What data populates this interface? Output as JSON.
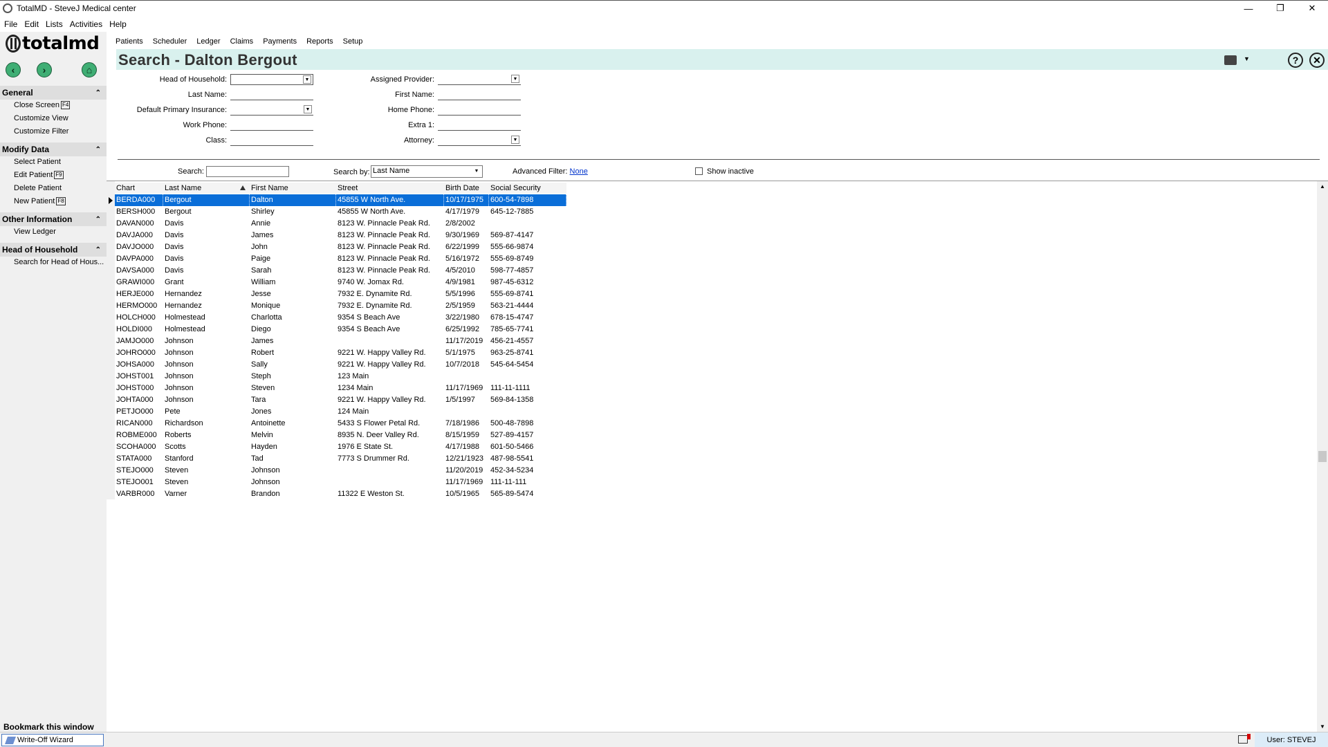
{
  "window": {
    "title": "TotalMD - SteveJ Medical center",
    "minimize_glyph": "—",
    "restore_glyph": "❐",
    "close_glyph": "✕"
  },
  "menubar": [
    "File",
    "Edit",
    "Lists",
    "Activities",
    "Help"
  ],
  "logo": {
    "text": "totalmd"
  },
  "toolbar": {
    "items": [
      "Patients",
      "Scheduler",
      "Ledger",
      "Claims",
      "Payments",
      "Reports",
      "Setup"
    ]
  },
  "nav": {
    "back_glyph": "‹",
    "forward_glyph": "›",
    "home_glyph": "⌂"
  },
  "sidebar": {
    "sections": [
      {
        "title": "General",
        "items": [
          {
            "label": "Close Screen",
            "key": "F4"
          },
          {
            "label": "Customize View",
            "key": ""
          },
          {
            "label": "Customize Filter",
            "key": ""
          }
        ]
      },
      {
        "title": "Modify Data",
        "items": [
          {
            "label": "Select Patient",
            "key": ""
          },
          {
            "label": "Edit Patient",
            "key": "F9"
          },
          {
            "label": "Delete Patient",
            "key": ""
          },
          {
            "label": "New Patient",
            "key": "F8"
          }
        ]
      },
      {
        "title": "Other Information",
        "items": [
          {
            "label": "View Ledger",
            "key": ""
          }
        ]
      },
      {
        "title": "Head of Household",
        "items": [
          {
            "label": "Search for Head of Hous...",
            "key": ""
          }
        ]
      }
    ],
    "chevron_glyph": "⌃",
    "bookmark": "Bookmark this window"
  },
  "page": {
    "title": "Search - Dalton Bergout",
    "help_glyph": "?",
    "close_glyph": "✕",
    "dropdown_glyph": "▼"
  },
  "form": {
    "head_of_household": {
      "label": "Head of Household:",
      "value": ""
    },
    "last_name": {
      "label": "Last Name:",
      "value": ""
    },
    "default_primary_insurance": {
      "label": "Default Primary Insurance:",
      "value": ""
    },
    "work_phone": {
      "label": "Work Phone:",
      "value": ""
    },
    "class": {
      "label": "Class:",
      "value": ""
    },
    "assigned_provider": {
      "label": "Assigned Provider:",
      "value": ""
    },
    "first_name": {
      "label": "First Name:",
      "value": ""
    },
    "home_phone": {
      "label": "Home Phone:",
      "value": ""
    },
    "extra1": {
      "label": "Extra 1:",
      "value": ""
    },
    "attorney": {
      "label": "Attorney:",
      "value": ""
    }
  },
  "search": {
    "label": "Search:",
    "value": "",
    "search_by_label": "Search by:",
    "search_by_value": "Last Name",
    "advanced_filter_label": "Advanced Filter:",
    "advanced_filter_value": "None",
    "show_inactive_label": "Show inactive",
    "show_inactive_checked": false
  },
  "grid": {
    "columns": [
      "Chart Number",
      "Last Name",
      "First Name",
      "Street",
      "Birth Date",
      "Social Security Number"
    ],
    "sorted_column": "Last Name",
    "selected_row": 0,
    "rows": [
      [
        "BERDA000",
        "Bergout",
        "Dalton",
        "45855 W North Ave.",
        "10/17/1975",
        "600-54-7898"
      ],
      [
        "BERSH000",
        "Bergout",
        "Shirley",
        "45855 W North Ave.",
        "4/17/1979",
        "645-12-7885"
      ],
      [
        "DAVAN000",
        "Davis",
        "Annie",
        "8123 W. Pinnacle Peak Rd.",
        "2/8/2002",
        ""
      ],
      [
        "DAVJA000",
        "Davis",
        "James",
        "8123 W. Pinnacle Peak Rd.",
        "9/30/1969",
        "569-87-4147"
      ],
      [
        "DAVJO000",
        "Davis",
        "John",
        "8123 W. Pinnacle Peak Rd.",
        "6/22/1999",
        "555-66-9874"
      ],
      [
        "DAVPA000",
        "Davis",
        "Paige",
        "8123 W. Pinnacle Peak Rd.",
        "5/16/1972",
        "555-69-8749"
      ],
      [
        "DAVSA000",
        "Davis",
        "Sarah",
        "8123 W. Pinnacle Peak Rd.",
        "4/5/2010",
        "598-77-4857"
      ],
      [
        "GRAWI000",
        "Grant",
        "William",
        "9740 W. Jomax Rd.",
        "4/9/1981",
        "987-45-6312"
      ],
      [
        "HERJE000",
        "Hernandez",
        "Jesse",
        "7932 E. Dynamite Rd.",
        "5/5/1996",
        "555-69-8741"
      ],
      [
        "HERMO000",
        "Hernandez",
        "Monique",
        "7932 E. Dynamite Rd.",
        "2/5/1959",
        "563-21-4444"
      ],
      [
        "HOLCH000",
        "Holmestead",
        "Charlotta",
        "9354 S Beach Ave",
        "3/22/1980",
        "678-15-4747"
      ],
      [
        "HOLDI000",
        "Holmestead",
        "Diego",
        "9354 S Beach Ave",
        "6/25/1992",
        "785-65-7741"
      ],
      [
        "JAMJO000",
        "Johnson",
        "James",
        "",
        "11/17/2019",
        "456-21-4557"
      ],
      [
        "JOHRO000",
        "Johnson",
        "Robert",
        "9221 W. Happy Valley Rd.",
        "5/1/1975",
        "963-25-8741"
      ],
      [
        "JOHSA000",
        "Johnson",
        "Sally",
        "9221 W. Happy Valley Rd.",
        "10/7/2018",
        "545-64-5454"
      ],
      [
        "JOHST001",
        "Johnson",
        "Steph",
        "123 Main",
        "",
        ""
      ],
      [
        "JOHST000",
        "Johnson",
        "Steven",
        "1234 Main",
        "11/17/1969",
        "111-11-1111"
      ],
      [
        "JOHTA000",
        "Johnson",
        "Tara",
        "9221 W. Happy Valley Rd.",
        "1/5/1997",
        "569-84-1358"
      ],
      [
        "PETJO000",
        "Pete",
        "Jones",
        "124 Main",
        "",
        ""
      ],
      [
        "RICAN000",
        "Richardson",
        "Antoinette",
        "5433 S Flower Petal Rd.",
        "7/18/1986",
        "500-48-7898"
      ],
      [
        "ROBME000",
        "Roberts",
        "Melvin",
        "8935 N. Deer Valley Rd.",
        "8/15/1959",
        "527-89-4157"
      ],
      [
        "SCOHA000",
        "Scotts",
        "Hayden",
        "1976 E State St.",
        "4/17/1988",
        "601-50-5466"
      ],
      [
        "STATA000",
        "Stanford",
        "Tad",
        "7773 S Drummer Rd.",
        "12/21/1923",
        "487-98-5541"
      ],
      [
        "STEJO000",
        "Steven",
        "Johnson",
        "",
        "11/20/2019",
        "452-34-5234"
      ],
      [
        "STEJO001",
        "Steven",
        "Johnson",
        "",
        "11/17/1969",
        "111-11-111"
      ],
      [
        "VARBR000",
        "Varner",
        "Brandon",
        "11322 E Weston St.",
        "10/5/1965",
        "565-89-5474"
      ]
    ]
  },
  "statusbar": {
    "write_off": "Write-Off Wizard",
    "user": "User: STEVEJ"
  },
  "colors": {
    "accent": "#0a6ed8",
    "header_band": "#d9f1ee",
    "nav_green": "#3fae74"
  }
}
